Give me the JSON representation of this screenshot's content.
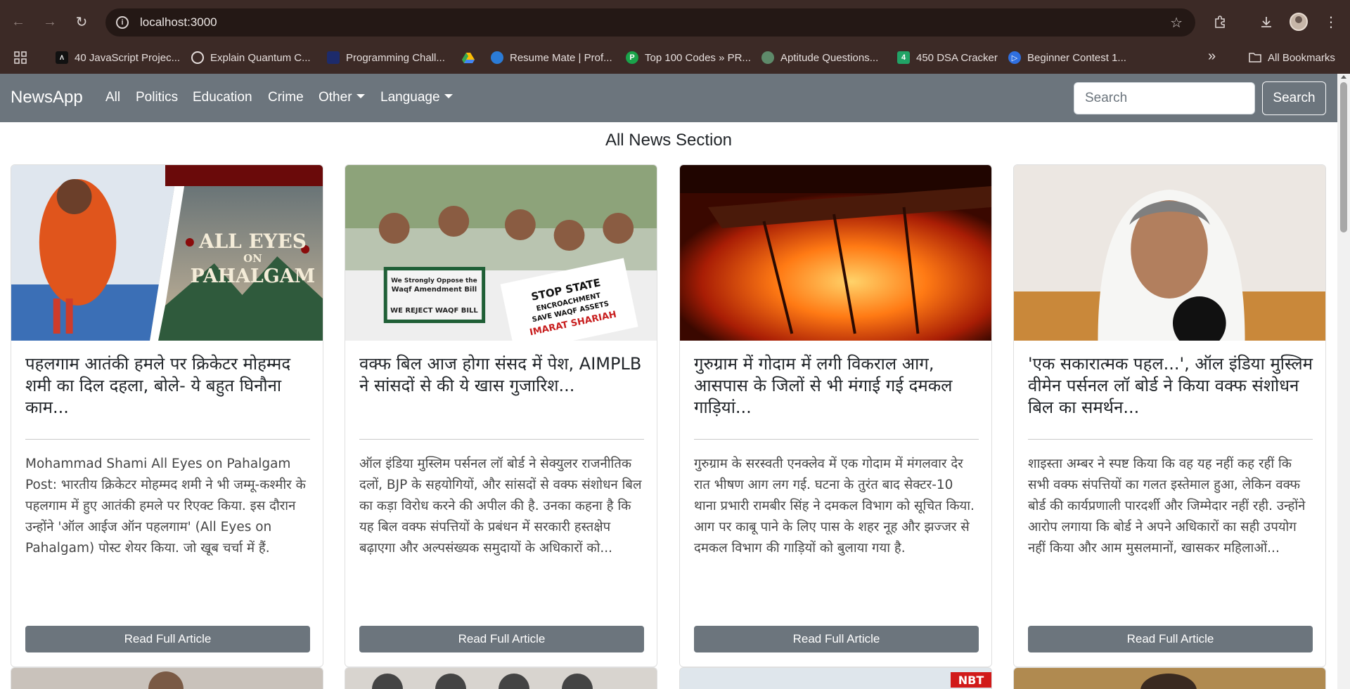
{
  "browser": {
    "url": "localhost:3000",
    "bookmarks": [
      {
        "label": "40 JavaScript Projec...",
        "icon": "dev-icon"
      },
      {
        "label": "Explain Quantum C...",
        "icon": "openai-icon"
      },
      {
        "label": "Programming Chall...",
        "icon": "codechef-icon"
      },
      {
        "label": "",
        "icon": "google-drive-icon"
      },
      {
        "label": "Resume Mate | Prof...",
        "icon": "resume-mate-icon"
      },
      {
        "label": "Top 100 Codes » PR...",
        "icon": "top-codes-icon"
      },
      {
        "label": "Aptitude Questions...",
        "icon": "aptitude-icon"
      },
      {
        "label": "450 DSA Cracker",
        "icon": "dsa-cracker-icon"
      },
      {
        "label": "Beginner Contest 1...",
        "icon": "contest-icon"
      }
    ],
    "all_bookmarks": "All Bookmarks"
  },
  "navbar": {
    "brand": "NewsApp",
    "links": [
      "All",
      "Politics",
      "Education",
      "Crime"
    ],
    "other": "Other",
    "language": "Language",
    "search_placeholder": "Search",
    "search_button": "Search"
  },
  "section_title": "All News Section",
  "cards": [
    {
      "title": "पहलगाम आतंकी हमले पर क्रिकेटर मोहम्मद शमी का दिल दहला, बोले- ये बहुत घिनौना काम...",
      "text": "Mohammad Shami All Eyes on Pahalgam Post: भारतीय क्रिकेटर मोहम्मद शमी ने भी जम्मू-कश्मीर के पहलगाम में हुए आतंकी हमले पर रिएक्ट किया. इस दौरान उन्होंने 'ऑल आईज ऑन पहलगाम' (All Eyes on Pahalgam) पोस्ट शेयर किया. जो खूब चर्चा में हैं.",
      "button": "Read Full Article",
      "image_text": [
        "ALL EYES",
        "ON",
        "PAHALGAM"
      ]
    },
    {
      "title": "वक्फ बिल आज होगा संसद में पेश, AIMPLB ने सांसदों से की ये खास गुजारिश...",
      "text": "ऑल इंडिया मुस्लिम पर्सनल लॉ बोर्ड ने सेक्युलर राजनीतिक दलों, BJP के सहयोगियों, और सांसदों से वक्फ संशोधन बिल का कड़ा विरोध करने की अपील की है. उनका कहना है कि यह बिल वक्फ संपत्तियों के प्रबंधन में सरकारी हस्तक्षेप बढ़ाएगा और अल्पसंख्यक समुदायों के अधिकारों को...",
      "button": "Read Full Article",
      "image_text": [
        "We Strongly Oppose the",
        "Waqf Amendment Bill",
        "WE REJECT WAQF BILL",
        "STOP STATE",
        "ENCROACHMENT",
        "SAVE WAQF ASSETS",
        "IMARAT SHARIAH"
      ]
    },
    {
      "title": "गुरुग्राम में गोदाम में लगी विकराल आग, आसपास के जिलों से भी मंगाई गई दमकल गाड़ियां...",
      "text": "गुरुग्राम के सरस्वती एनक्लेव में एक गोदाम में मंगलवार देर रात भीषण आग लग गई. घटना के तुरंत बाद सेक्टर-10 थाना प्रभारी रामबीर सिंह ने दमकल विभाग को सूचित किया. आग पर काबू पाने के लिए पास के शहर नूह और झज्जर से दमकल विभाग की गाड़ियों को बुलाया गया है.",
      "button": "Read Full Article",
      "image_text": []
    },
    {
      "title": "'एक सकारात्मक पहल...', ऑल इंडिया मुस्लिम वीमेन पर्सनल लॉ बोर्ड ने किया वक्फ संशोधन बिल का समर्थन...",
      "text": "शाइस्ता अम्बर ने स्पष्ट किया कि वह यह नहीं कह रहीं कि सभी वक्फ संपत्तियों का गलत इस्तेमाल हुआ, लेकिन वक्फ बोर्ड की कार्यप्रणाली पारदर्शी और जिम्मेदार नहीं रही. उन्होंने आरोप लगाया कि बोर्ड ने अपने अधिकारों का सही उपयोग नहीं किया और आम मुसलमानों, खासकर महिलाओं...",
      "button": "Read Full Article",
      "image_text": []
    }
  ],
  "peek_text": [
    "NBT"
  ]
}
